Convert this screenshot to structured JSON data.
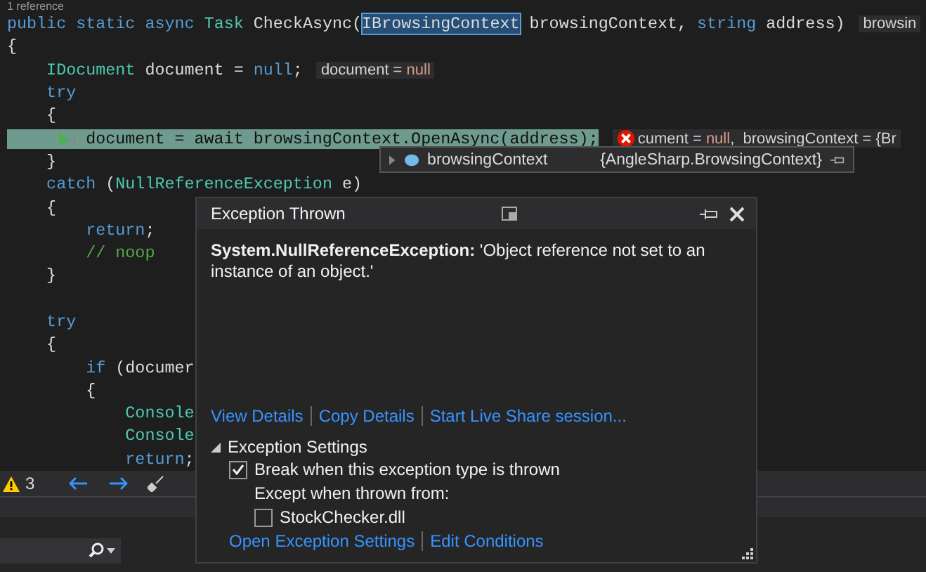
{
  "editor": {
    "codelens": "1 reference",
    "code_lines": [
      {
        "current": false,
        "tokens": [
          {
            "kind": "keyword",
            "text": "public"
          },
          {
            "kind": "keyword",
            "text": " static"
          },
          {
            "kind": "keyword",
            "text": " async"
          },
          {
            "kind": "type",
            "text": " Task"
          },
          {
            "kind": "plain",
            "text": " CheckAsync("
          },
          {
            "kind": "boxed",
            "text": "IBrowsingContext"
          },
          {
            "kind": "plain",
            "text": " browsingContext,"
          },
          {
            "kind": "keyword",
            "text": " string"
          },
          {
            "kind": "plain",
            "text": " address)"
          }
        ],
        "hint": {
          "error": false,
          "parts": [
            {
              "kind": "plain",
              "text": "browsin"
            }
          ]
        }
      },
      {
        "current": false,
        "tokens": [
          {
            "kind": "plain",
            "text": "{"
          }
        ]
      },
      {
        "current": false,
        "tokens": [
          {
            "kind": "type",
            "text": "    IDocument"
          },
          {
            "kind": "plain",
            "text": " document ="
          },
          {
            "kind": "keyword",
            "text": " null"
          },
          {
            "kind": "plain",
            "text": ";"
          }
        ],
        "hint": {
          "error": false,
          "parts": [
            {
              "kind": "plain",
              "text": "document = "
            },
            {
              "kind": "null",
              "text": "null"
            }
          ]
        }
      },
      {
        "current": false,
        "tokens": [
          {
            "kind": "keyword",
            "text": "    try"
          }
        ]
      },
      {
        "current": false,
        "tokens": [
          {
            "kind": "plain",
            "text": "    {"
          }
        ]
      },
      {
        "current": true,
        "tokens": [
          {
            "kind": "plain",
            "text": "        document = await browsingContext.OpenAsync(address);"
          }
        ],
        "hint": {
          "error": true,
          "parts": [
            {
              "kind": "plain",
              "text": "cument = "
            },
            {
              "kind": "null",
              "text": "null"
            },
            {
              "kind": "plain",
              "text": ",  browsingContext = {Br"
            }
          ]
        }
      },
      {
        "current": false,
        "tokens": [
          {
            "kind": "plain",
            "text": "    }"
          }
        ]
      },
      {
        "current": false,
        "tokens": [
          {
            "kind": "keyword",
            "text": "    catch"
          },
          {
            "kind": "plain",
            "text": " ("
          },
          {
            "kind": "type",
            "text": "NullReferenceException"
          },
          {
            "kind": "plain",
            "text": " e)"
          }
        ]
      },
      {
        "current": false,
        "tokens": [
          {
            "kind": "plain",
            "text": "    {"
          }
        ]
      },
      {
        "current": false,
        "tokens": [
          {
            "kind": "keyword",
            "text": "        return"
          },
          {
            "kind": "plain",
            "text": ";"
          }
        ]
      },
      {
        "current": false,
        "tokens": [
          {
            "kind": "comment",
            "text": "        // noop"
          }
        ]
      },
      {
        "current": false,
        "tokens": [
          {
            "kind": "plain",
            "text": "    }"
          }
        ]
      },
      {
        "current": false
      },
      {
        "current": false,
        "tokens": [
          {
            "kind": "keyword",
            "text": "    try"
          }
        ]
      },
      {
        "current": false,
        "tokens": [
          {
            "kind": "plain",
            "text": "    {"
          }
        ]
      },
      {
        "current": false,
        "tokens": [
          {
            "kind": "keyword",
            "text": "        if"
          },
          {
            "kind": "plain",
            "text": " (documer"
          }
        ]
      },
      {
        "current": false,
        "tokens": [
          {
            "kind": "plain",
            "text": "        {"
          }
        ]
      },
      {
        "current": false,
        "tokens": [
          {
            "kind": "type",
            "text": "            Console"
          }
        ]
      },
      {
        "current": false,
        "tokens": [
          {
            "kind": "type",
            "text": "            Console"
          }
        ]
      },
      {
        "current": false,
        "tokens": [
          {
            "kind": "keyword",
            "text": "            return"
          },
          {
            "kind": "plain",
            "text": ";"
          }
        ]
      }
    ]
  },
  "datatip": {
    "name": "browsingContext",
    "value": "{AngleSharp.BrowsingContext}"
  },
  "popup": {
    "title": "Exception Thrown",
    "message": "**System.NullReferenceException:** 'Object reference not set to an instance of an object.'",
    "links": [
      "View Details",
      "Copy Details",
      "Start Live Share session..."
    ],
    "settings": {
      "title": "Exception Settings",
      "expanded": true,
      "break_option": {
        "label": "Break when this exception type is thrown",
        "checked": true
      },
      "except_label": "Except when thrown from:",
      "modules": [
        {
          "label": "StockChecker.dll",
          "checked": false
        }
      ]
    },
    "bottom_links": [
      "Open Exception Settings",
      "Edit Conditions"
    ]
  },
  "toolbar": {
    "warnings": "3"
  }
}
